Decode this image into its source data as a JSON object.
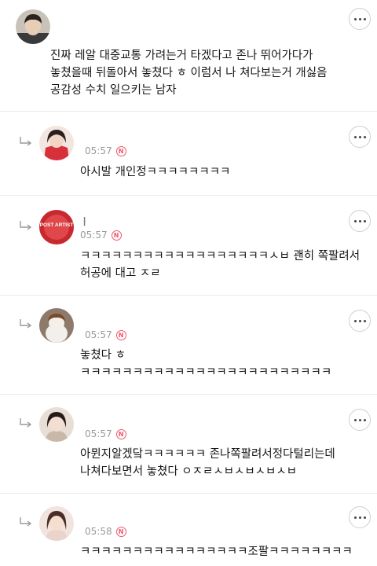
{
  "comments": [
    {
      "name": "",
      "time": "",
      "badge": "N",
      "text": "진짜 레알 대중교통 가려는거 타겠다고 존나 뛰어가다가\n놓쳤을때 뒤돌아서 놓쳤다 ㅎ 이럼서 나 쳐다보는거 개싫음\n공감성 수치 일으키는 남자"
    },
    {
      "name": "",
      "time": "05:57",
      "badge": "N",
      "text": "아시발 개인정ㅋㅋㅋㅋㅋㅋㅋㅋ"
    },
    {
      "name": "ㅣ",
      "time": "05:57",
      "badge": "N",
      "avatar_text": "POST ARTIST",
      "text": "ㅋㅋㅋㅋㅋㅋㅋㅋㅋㅋㅋㅋㅋㅋㅋㅋㅋㅋㅅㅂ 괜히 쪽팔려서\n허공에 대고 ㅈㄹ"
    },
    {
      "name": "",
      "time": "05:57",
      "badge": "N",
      "text": "놓쳤다 ㅎ\nㅋㅋㅋㅋㅋㅋㅋㅋㅋㅋㅋㅋㅋㅋㅋㅋㅋㅋㅋㅋㅋㅋㅋㅋ"
    },
    {
      "name": "",
      "time": "05:57",
      "badge": "N",
      "text": "아뮌지알겠닼ㅋㅋㅋㅋㅋㅋ 존나쪽팔려서정다털리는데\n나쳐다보면서 놓쳤다 ㅇㅈㄹㅅㅂㅅㅂㅅㅂㅅㅂ"
    },
    {
      "name": "",
      "time": "05:58",
      "badge": "N",
      "text": "ㅋㅋㅋㅋㅋㅋㅋㅋㅋㅋㅋㅋㅋㅋㅋㅋ조팔ㅋㅋㅋㅋㅋㅋㅋㅋ"
    }
  ]
}
